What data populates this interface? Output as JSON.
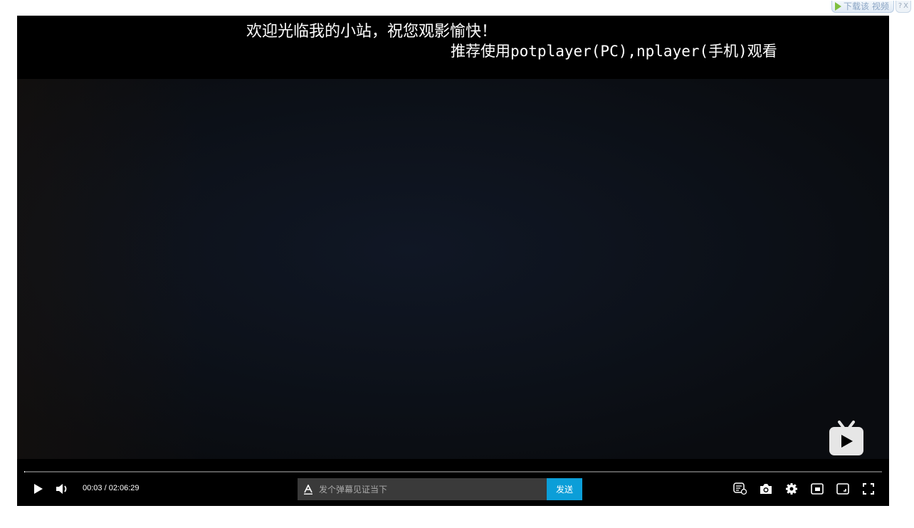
{
  "download_badge": {
    "label": "下载该 视频",
    "help": "?",
    "close": "X"
  },
  "overlay": {
    "welcome": "欢迎光临我的小站，祝您观影愉快！",
    "recommend": "推荐使用potplayer(PC),nplayer(手机)观看"
  },
  "player": {
    "time": "00:03 / 02:06:29",
    "progress_fraction": 0.0004,
    "danmaku_placeholder": "发个弹幕见证当下",
    "send_label": "发送"
  },
  "icons": {
    "play": "play-icon",
    "volume": "volume-icon",
    "danmaku_style": "text-style-icon",
    "danmaku_toggle": "danmaku-settings-icon",
    "screenshot": "camera-icon",
    "settings": "gear-icon",
    "pip": "picture-in-picture-icon",
    "webscreen": "web-fullscreen-icon",
    "fullscreen": "fullscreen-icon",
    "logo": "tv-logo-icon"
  },
  "colors": {
    "accent": "#0b9ed8",
    "background": "#000000"
  }
}
